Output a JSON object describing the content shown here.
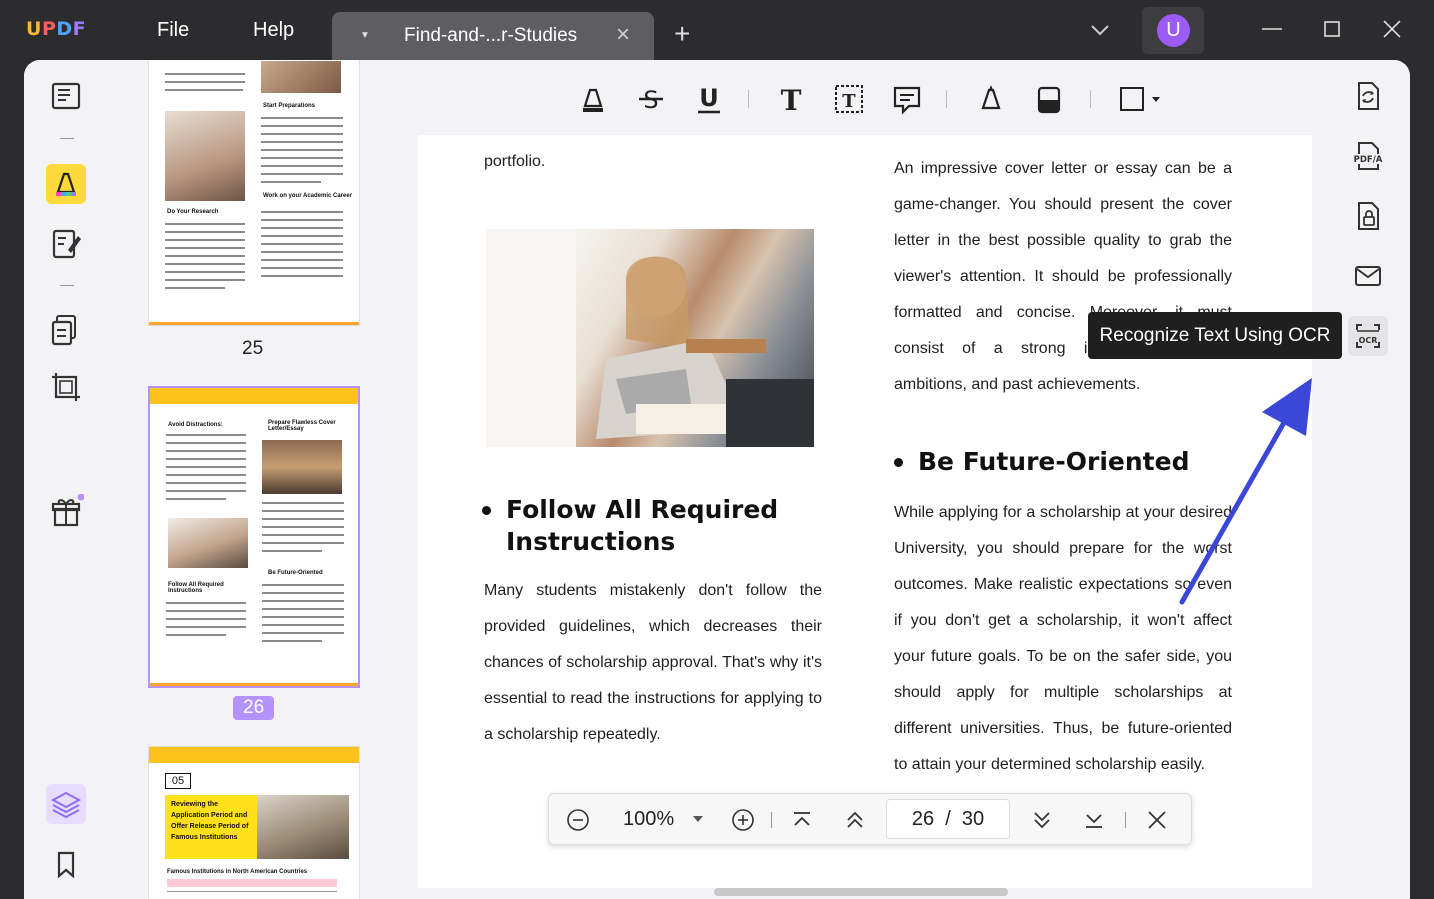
{
  "app": {
    "logo": {
      "u": "U",
      "p": "P",
      "d": "D",
      "f": "F"
    },
    "menu": {
      "file": "File",
      "help": "Help"
    },
    "tab": {
      "title": "Find-and-...r-Studies"
    },
    "user_initial": "U"
  },
  "thumbnails": {
    "page25_num": "25",
    "page26_num": "26",
    "page26": {
      "h1": "Avoid Distractions:",
      "h2": "Prepare Flawless Cover Letter/Essay",
      "h3": "Follow All Required Instructions",
      "h4": "Be Future-Oriented"
    },
    "page25": {
      "h1": "Start Preparations",
      "h2": "Do Your Research",
      "h3": "Work on your Academic Career"
    },
    "page27": {
      "badge": "05",
      "title": "Reviewing the Application Period and Offer Release Period of Famous Institutions",
      "table_title": "Famous Institutions in North American Countries"
    }
  },
  "document": {
    "left_top": "portfolio.",
    "left_heading": "Follow All Required Instructions",
    "left_para": "Many students mistakenly don't follow the provided guidelines, which decreases their chances of scholarship approval. That's why it's essential to read the instructions for applying to a scholarship repeatedly.",
    "right_para1": "An impressive cover letter or essay can be a game-changer. You should present the cover letter in the best possible quality to grab the viewer's attention. It should be professionally formatted and concise. Moreover, it must consist of a strong introduction, goals, ambitions, and past achievements.",
    "right_heading": "Be Future-Oriented",
    "right_para2": "While applying for a scholarship at your desired University, you should prepare for the worst outcomes. Make realistic expectations so even if you don't get a scholarship, it won't affect your future goals. To be on the safer side, you should apply for multiple scholarships at different universities. Thus, be future-oriented to attain your determined scholarship easily."
  },
  "zoombar": {
    "zoom": "100%",
    "current_page": "26",
    "separator": "/",
    "total_pages": "30"
  },
  "tooltip": {
    "text": "Recognize Text Using OCR"
  },
  "rightbar": {
    "pdfa_label": "PDF/A",
    "ocr_label": "OCR"
  },
  "colors": {
    "accent_purple": "#b493ff",
    "highlight_yellow": "#ffd83a",
    "arrow_blue": "#3b47d6",
    "thumb_header": "#ffc21a"
  }
}
